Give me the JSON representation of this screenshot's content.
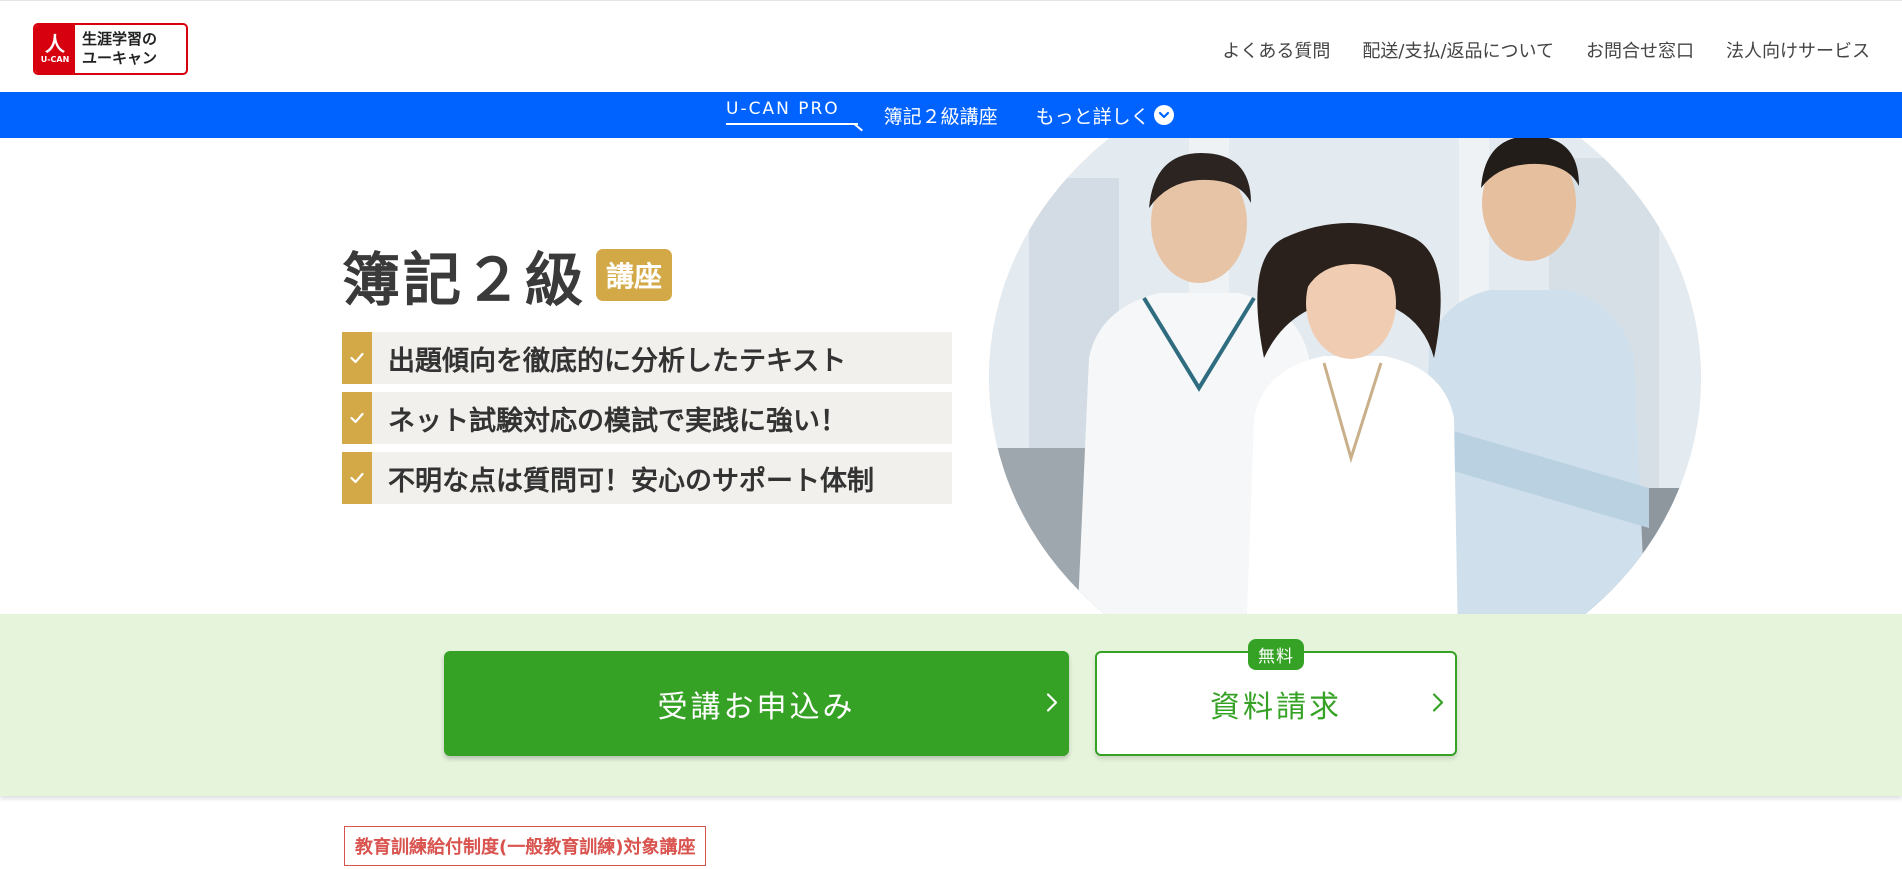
{
  "header": {
    "logo": {
      "symbol": "人",
      "brand": "U-CAN",
      "line1": "生涯学習の",
      "line2": "ユーキャン"
    },
    "nav": [
      {
        "label": "よくある質問"
      },
      {
        "label": "配送/支払/返品について"
      },
      {
        "label": "お問合せ窓口"
      },
      {
        "label": "法人向けサービス"
      }
    ]
  },
  "subnav": {
    "pro_logo": "U-CAN PRO",
    "course": "簿記２級講座",
    "more": "もっと詳しく"
  },
  "hero": {
    "title": "簿記２級",
    "badge": "講座",
    "features": [
      {
        "text": "出題傾向を徹底的に分析したテキスト"
      },
      {
        "text": "ネット試験対応の模試で実践に強い！"
      },
      {
        "text": "不明な点は質問可！安心のサポート体制"
      }
    ]
  },
  "cta": {
    "apply_label": "受講お申込み",
    "request_label": "資料請求",
    "free_badge": "無料"
  },
  "notice": {
    "tag": "教育訓練給付制度(一般教育訓練)対象講座"
  },
  "colors": {
    "brand_red": "#d7000f",
    "nav_blue": "#0063ff",
    "accent_gold": "#d3a948",
    "cta_green": "#36a225",
    "band_green": "#e6f4dc",
    "tag_red": "#d9534f"
  }
}
